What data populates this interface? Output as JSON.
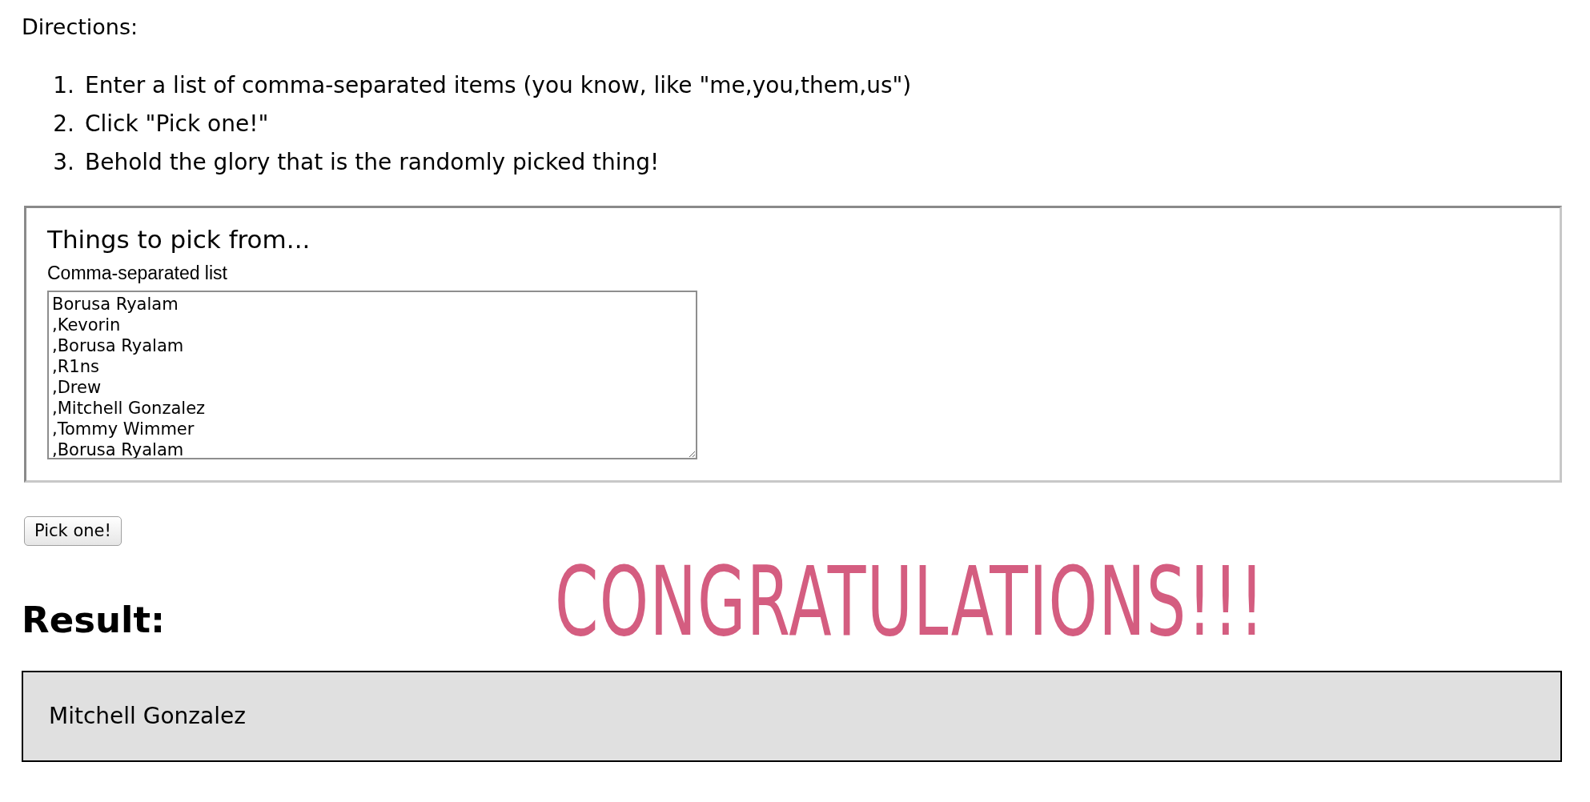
{
  "directions": {
    "heading": "Directions:",
    "steps": [
      {
        "number": "1.",
        "text": "Enter a list of comma-separated items (you know, like \"me,you,them,us\")"
      },
      {
        "number": "2.",
        "text": "Click \"Pick one!\""
      },
      {
        "number": "3.",
        "text": "Behold the glory that is the randomly picked thing!"
      }
    ]
  },
  "form": {
    "legend": "Things to pick from...",
    "label": "Comma-separated list",
    "value": "Borusa Ryalam\n,Kevorin\n,Borusa Ryalam\n,R1ns\n,Drew\n,Mitchell Gonzalez\n,Tommy Wimmer\n,Borusa Ryalam"
  },
  "button": "Pick one!",
  "result": {
    "heading": "Result:",
    "banner": "CONGRATULATIONS!!!",
    "value": "Mitchell Gonzalez"
  }
}
